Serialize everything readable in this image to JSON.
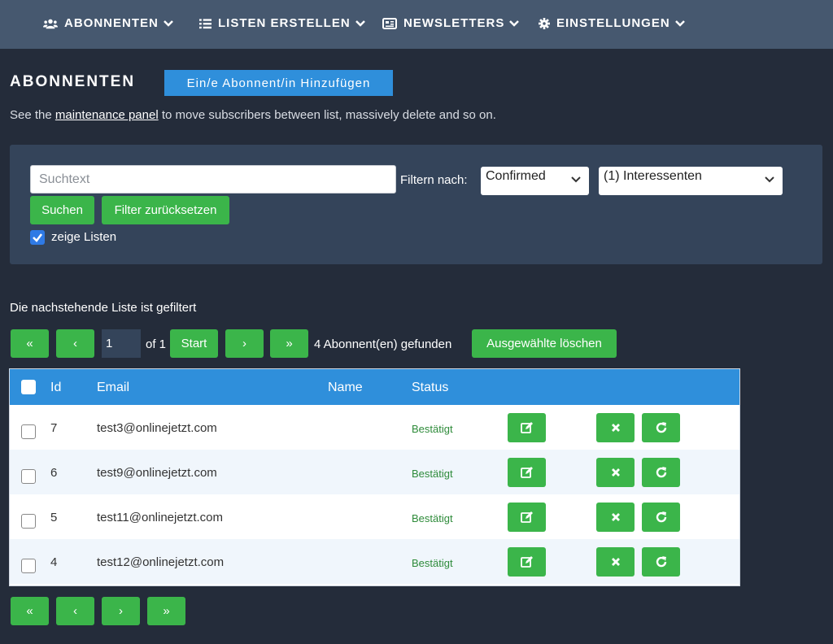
{
  "nav": {
    "items": [
      {
        "label": "ABONNENTEN",
        "icon": "users-icon"
      },
      {
        "label": "LISTEN ERSTELLEN",
        "icon": "list-icon"
      },
      {
        "label": "NEWSLETTERS",
        "icon": "newspaper-icon"
      },
      {
        "label": "EINSTELLUNGEN",
        "icon": "gear-icon"
      }
    ]
  },
  "page": {
    "title": "ABONNENTEN",
    "add_button": "Ein/e Abonnent/in Hinzufügen",
    "info_prefix": "See the ",
    "info_link": "maintenance panel",
    "info_suffix": " to move subscribers between list, massively delete and so on."
  },
  "filter": {
    "search_placeholder": "Suchtext",
    "filter_label": "Filtern nach:",
    "status_select": "Confirmed",
    "list_select": "(1) Interessenten",
    "search_button": "Suchen",
    "reset_button": "Filter zurücksetzen",
    "show_lists_label": "zeige Listen",
    "show_lists_checked": true
  },
  "filtered_note": "Die nachstehende Liste ist gefiltert",
  "pagination": {
    "first": "«",
    "prev": "‹",
    "next": "›",
    "last": "»",
    "page_value": "1",
    "of_label": "of 1",
    "start_button": "Start",
    "found_label": "4 Abonnent(en) gefunden",
    "delete_selected": "Ausgewählte löschen"
  },
  "table": {
    "headers": {
      "id": "Id",
      "email": "Email",
      "name": "Name",
      "status": "Status"
    },
    "rows": [
      {
        "id": "7",
        "email": "test3@onlinejetzt.com",
        "name": "",
        "status": "Bestätigt"
      },
      {
        "id": "6",
        "email": "test9@onlinejetzt.com",
        "name": "",
        "status": "Bestätigt"
      },
      {
        "id": "5",
        "email": "test11@onlinejetzt.com",
        "name": "",
        "status": "Bestätigt"
      },
      {
        "id": "4",
        "email": "test12@onlinejetzt.com",
        "name": "",
        "status": "Bestätigt"
      }
    ]
  },
  "colors": {
    "nav_bg": "#46586f",
    "page_bg": "#242c3a",
    "panel_bg": "#34445a",
    "accent_blue": "#2f8fdb",
    "button_green": "#3bb54a",
    "status_green": "#2e8b3a"
  }
}
